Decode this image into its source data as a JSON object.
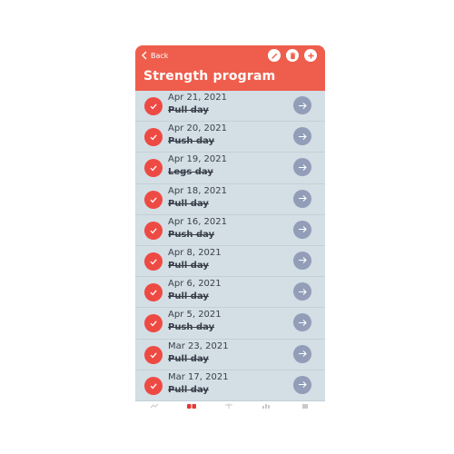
{
  "header": {
    "back_label": "Back",
    "title": "Strength program",
    "background_color": "#ef5e4c",
    "icons": [
      "edit-icon",
      "trash-icon",
      "plus-icon"
    ]
  },
  "workouts": [
    {
      "date": "Apr 21, 2021",
      "name": "Pull day",
      "completed": true
    },
    {
      "date": "Apr 20, 2021",
      "name": "Push day",
      "completed": true
    },
    {
      "date": "Apr 19, 2021",
      "name": "Legs day",
      "completed": true
    },
    {
      "date": "Apr 18, 2021",
      "name": "Pull day",
      "completed": true
    },
    {
      "date": "Apr 16, 2021",
      "name": "Push day",
      "completed": true
    },
    {
      "date": "Apr 8, 2021",
      "name": "Pull day",
      "completed": true
    },
    {
      "date": "Apr 6, 2021",
      "name": "Pull day",
      "completed": true
    },
    {
      "date": "Apr 5, 2021",
      "name": "Push day",
      "completed": true
    },
    {
      "date": "Mar 23, 2021",
      "name": "Pull day",
      "completed": true
    },
    {
      "date": "Mar 17, 2021",
      "name": "Pull day",
      "completed": true
    }
  ],
  "colors": {
    "check": "#ee4a44",
    "arrow": "#929db8",
    "list_bg": "#d3dee5"
  },
  "tabbar": {
    "icons": [
      "stats-icon",
      "heart-icon",
      "figure-icon",
      "bars-icon",
      "calendar-icon"
    ]
  }
}
